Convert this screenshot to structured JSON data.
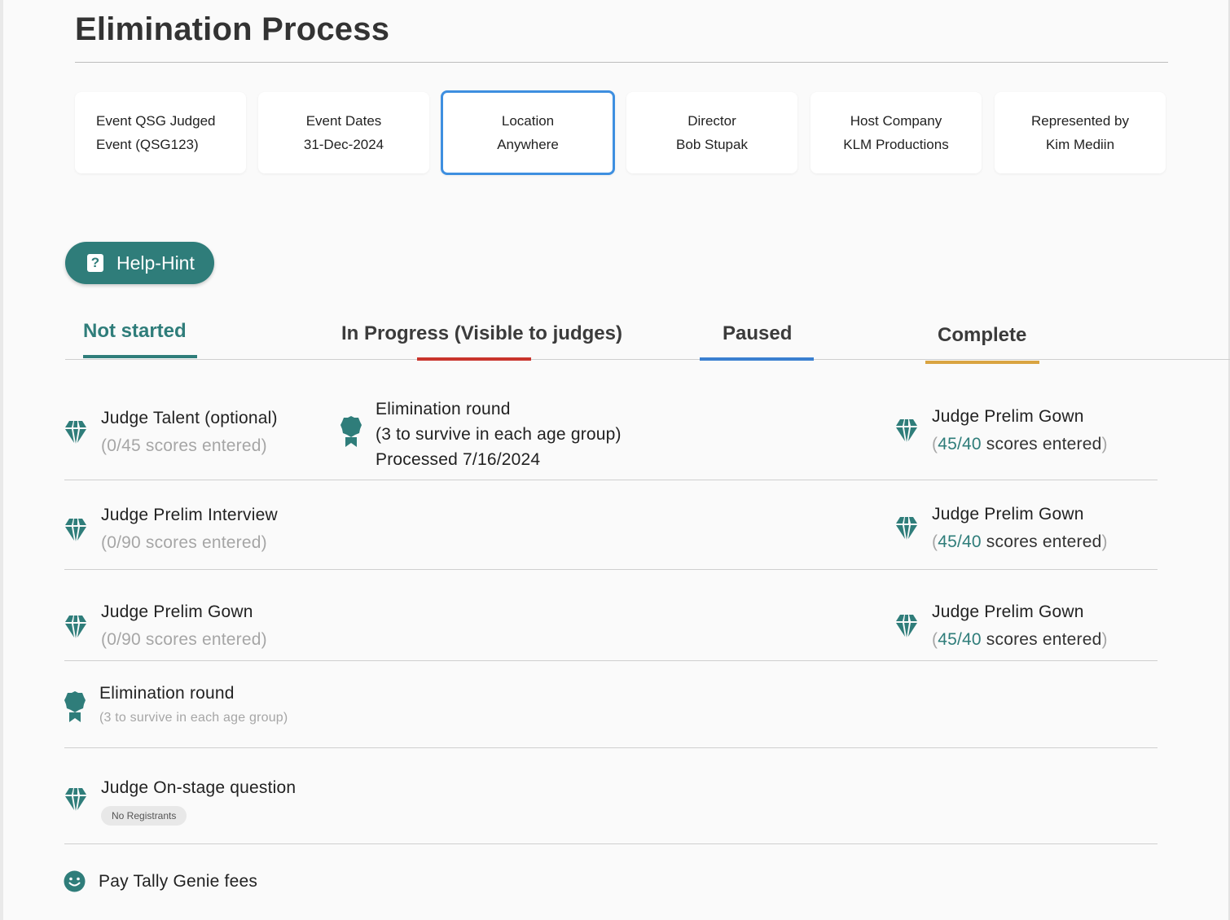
{
  "page": {
    "title": "Elimination Process"
  },
  "cards": [
    {
      "line1": "Event QSG Judged",
      "line2": "Event (QSG123)"
    },
    {
      "line1": "Event Dates",
      "line2": "31-Dec-2024"
    },
    {
      "line1": "Location",
      "line2": "Anywhere"
    },
    {
      "line1": "Director",
      "line2": "Bob Stupak"
    },
    {
      "line1": "Host Company",
      "line2": "KLM Productions"
    },
    {
      "line1": "Represented by",
      "line2": "Kim Mediin"
    }
  ],
  "help": {
    "label": "Help-Hint",
    "icon": "question-icon"
  },
  "tabs": [
    {
      "label": "Not started",
      "color": "#2f7d7a"
    },
    {
      "label": "In Progress (Visible to judges)",
      "color": "#c9342c"
    },
    {
      "label": "Paused",
      "color": "#3a7fd0"
    },
    {
      "label": "Complete",
      "color": "#d9a441"
    }
  ],
  "tasks": {
    "judge_talent": {
      "title": "Judge Talent (optional)",
      "sub": "(0/45 scores entered)",
      "icon": "diamond-icon"
    },
    "elim_progress": {
      "line1": "Elimination round",
      "line2": "(3 to survive in each age group)",
      "line3": "Processed 7/16/2024",
      "icon": "award-icon"
    },
    "gown_complete_1": {
      "title": "Judge Prelim Gown",
      "open": "(",
      "count": "45/40",
      "rest": " scores entered",
      "close": ")",
      "icon": "diamond-icon"
    },
    "prelim_interview": {
      "title": "Judge Prelim Interview",
      "sub": "(0/90 scores entered)",
      "icon": "diamond-icon"
    },
    "gown_complete_2": {
      "title": "Judge Prelim Gown",
      "open": "(",
      "count": "45/40",
      "rest": " scores entered",
      "close": ")",
      "icon": "diamond-icon"
    },
    "prelim_gown": {
      "title": "Judge Prelim Gown",
      "sub": "(0/90 scores entered)",
      "icon": "diamond-icon"
    },
    "gown_complete_3": {
      "title": "Judge Prelim Gown",
      "open": "(",
      "count": "45/40",
      "rest": " scores entered",
      "close": ")",
      "icon": "diamond-icon"
    },
    "elim_round": {
      "title": "Elimination round",
      "sub": "(3 to survive in each age group)",
      "icon": "award-icon"
    },
    "onstage": {
      "title": "Judge On-stage question",
      "badge": "No Registrants",
      "icon": "diamond-icon"
    },
    "pay_fees": {
      "title": "Pay Tally Genie fees",
      "icon": "smiley-icon"
    }
  },
  "colors": {
    "accent": "#2f7d7a",
    "selected_border": "#3e8fe0"
  }
}
